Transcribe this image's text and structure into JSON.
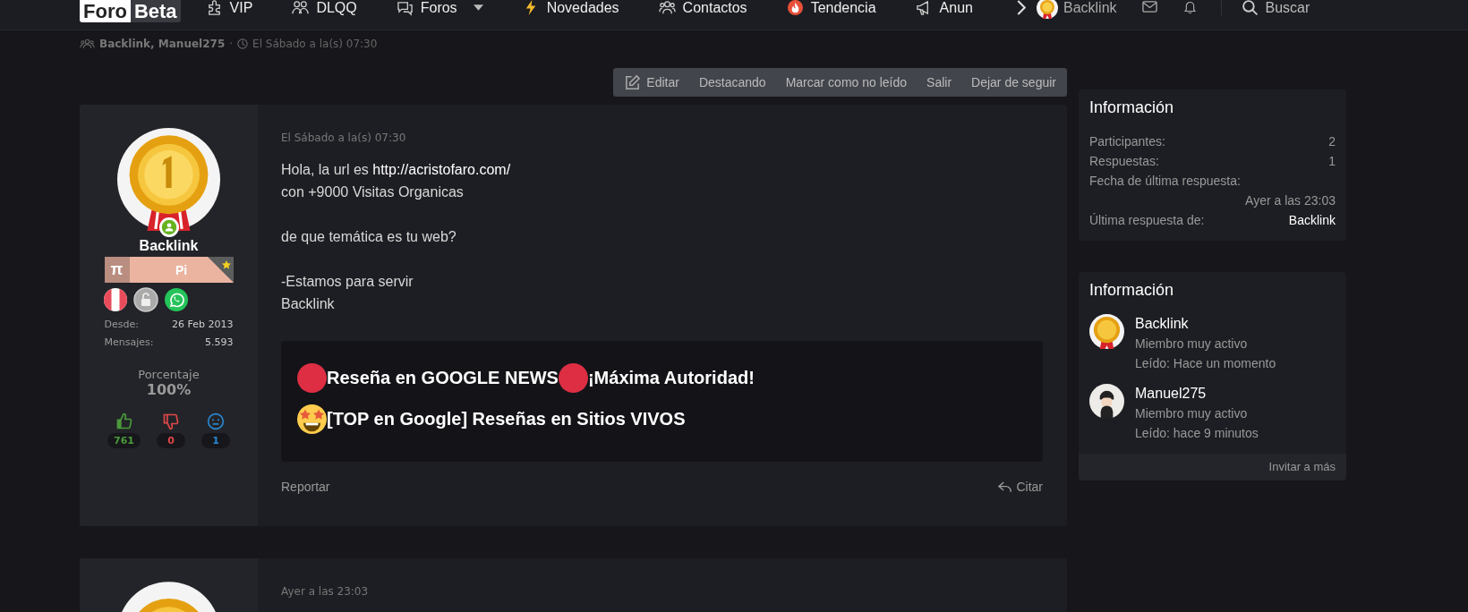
{
  "nav": {
    "logo": {
      "light": "Foro",
      "dark": "Beta"
    },
    "items": [
      {
        "kind": "puzzle",
        "label": "VIP",
        "caret": false
      },
      {
        "kind": "people",
        "label": "DLQQ",
        "caret": false
      },
      {
        "kind": "chat",
        "label": "Foros",
        "caret": true
      },
      {
        "kind": "bolt",
        "label": "Novedades",
        "caret": false
      },
      {
        "kind": "group",
        "label": "Contactos",
        "caret": false
      },
      {
        "kind": "flame",
        "label": "Tendencia",
        "caret": false
      },
      {
        "kind": "megaphone",
        "label": "Anun",
        "caret": false
      }
    ],
    "user": "Backlink",
    "search": "Buscar"
  },
  "breadcrumb": {
    "participants": "Backlink, Manuel275",
    "separator": "·",
    "time": "El Sábado a la(s) 07:30"
  },
  "actions": [
    {
      "label": "Editar",
      "icon": true
    },
    {
      "label": "Destacando",
      "icon": false
    },
    {
      "label": "Marcar como no leído",
      "icon": false
    },
    {
      "label": "Salir",
      "icon": false
    },
    {
      "label": "Dejar de seguir",
      "icon": false
    }
  ],
  "post": {
    "user": {
      "name": "Backlink",
      "online": true,
      "banner": {
        "symbol": "π",
        "title": "Pi",
        "starred": true
      },
      "badges": [
        {
          "kind": "flag"
        },
        {
          "kind": "lock"
        },
        {
          "kind": "whatsapp"
        }
      ],
      "stats": [
        {
          "label": "Desde:",
          "value": "26 Feb 2013"
        },
        {
          "label": "Mensajes:",
          "value": "5.593"
        }
      ],
      "percent_label": "Porcentaje",
      "percent": "100%",
      "reactions": [
        {
          "kind": "like",
          "count": "761",
          "color": "#4a9a3a"
        },
        {
          "kind": "dislike",
          "count": "0",
          "color": "#e04848"
        },
        {
          "kind": "neutral",
          "count": "1",
          "color": "#2a86d0"
        }
      ]
    },
    "date": "El Sábado a la(s) 07:30",
    "paragraphs": [
      [
        {
          "text": "Hola, la url es ",
          "link": "http://acristofaro.com/"
        },
        {
          "text": "con +9000 Visitas Organicas"
        }
      ],
      [
        {
          "text": "de que temática es tu web?"
        }
      ],
      [
        {
          "text": "-Estamos para servir"
        },
        {
          "text": "Backlink"
        }
      ]
    ],
    "signature": [
      [
        {
          "kind": "dot"
        },
        {
          "kind": "text",
          "text": "Reseña en GOOGLE NEWS"
        },
        {
          "kind": "dot"
        },
        {
          "kind": "text",
          "text": "¡Máxima Autoridad!"
        }
      ],
      [
        {
          "kind": "star-eyes"
        },
        {
          "kind": "text",
          "text": "[TOP en Google] Reseñas en Sitios VIVOS"
        }
      ]
    ],
    "report": "Reportar",
    "quote": "Citar"
  },
  "next_post": {
    "date": "Ayer a las 23:03"
  },
  "info": {
    "title": "Información",
    "rows": [
      {
        "kind": "inline",
        "label": "Participantes:",
        "value": "2"
      },
      {
        "kind": "inline",
        "label": "Respuestas:",
        "value": "1"
      },
      {
        "kind": "stacked",
        "label": "Fecha de última respuesta:",
        "value": "Ayer a las 23:03"
      },
      {
        "kind": "link",
        "label": "Última respuesta de:",
        "value": "Backlink"
      }
    ]
  },
  "members": {
    "title": "Información",
    "list": [
      {
        "kind": "medal",
        "name": "Backlink",
        "role": "Miembro muy activo",
        "read": "Leído: Hace un momento"
      },
      {
        "kind": "person",
        "name": "Manuel275",
        "role": "Miembro muy activo",
        "read": "Leído: hace 9 minutos"
      }
    ],
    "footer": "Invitar a más"
  }
}
